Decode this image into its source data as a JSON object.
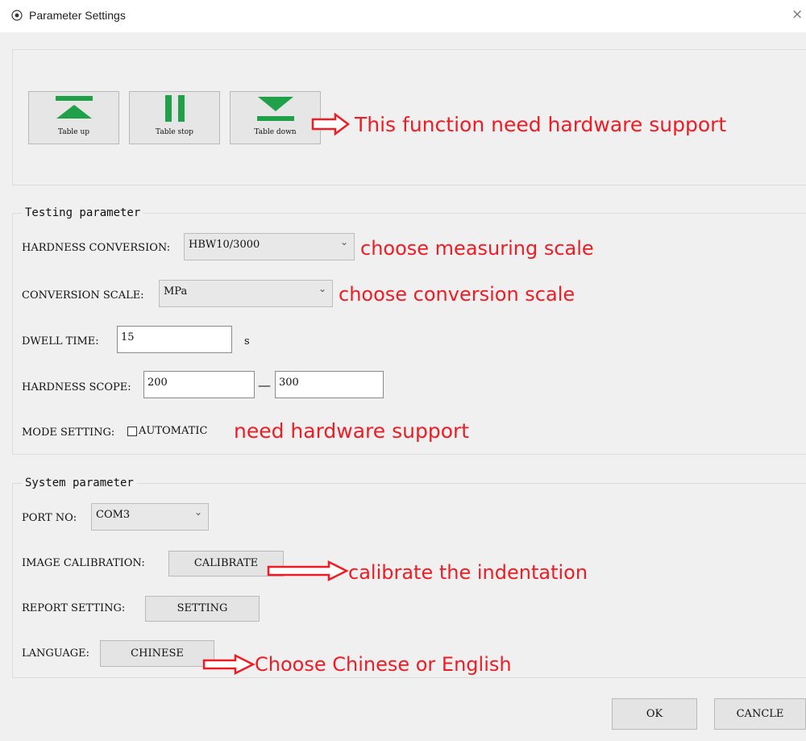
{
  "window": {
    "title": "Parameter Settings",
    "close_glyph": "×"
  },
  "table_controls": {
    "buttons": [
      {
        "label": "Table up",
        "icon": "arrow-up-icon"
      },
      {
        "label": "Table stop",
        "icon": "pause-icon"
      },
      {
        "label": "Table down",
        "icon": "arrow-down-icon"
      }
    ],
    "note": "This function need hardware support"
  },
  "testing": {
    "legend": "Testing parameter",
    "hardness_conversion": {
      "label": "HARDNESS CONVERSION:",
      "value": "HBW10/3000",
      "note": "choose measuring scale"
    },
    "conversion_scale": {
      "label": "CONVERSION SCALE:",
      "value": "MPa",
      "note": "choose conversion scale"
    },
    "dwell_time": {
      "label": "DWELL TIME:",
      "value": "15",
      "unit": "s"
    },
    "hardness_scope": {
      "label": "HARDNESS SCOPE:",
      "min": "200",
      "dash": "—",
      "max": "300"
    },
    "mode_setting": {
      "label": "MODE SETTING:",
      "checkbox_label": "AUTOMATIC",
      "checked": false,
      "note": "need hardware support"
    }
  },
  "system": {
    "legend": "System parameter",
    "port_no": {
      "label": "PORT NO:",
      "value": "COM3"
    },
    "image_calibration": {
      "label": "IMAGE CALIBRATION:",
      "button": "CALIBRATE",
      "note": "calibrate the indentation"
    },
    "report_setting": {
      "label": "REPORT SETTING:",
      "button": "SETTING"
    },
    "language": {
      "label": "LANGUAGE:",
      "button": "CHINESE",
      "note": "Choose Chinese or English"
    }
  },
  "footer": {
    "ok": "OK",
    "cancel": "CANCLE"
  },
  "colors": {
    "accent_green": "#21a04a",
    "annotation_red": "#ee1c24"
  }
}
